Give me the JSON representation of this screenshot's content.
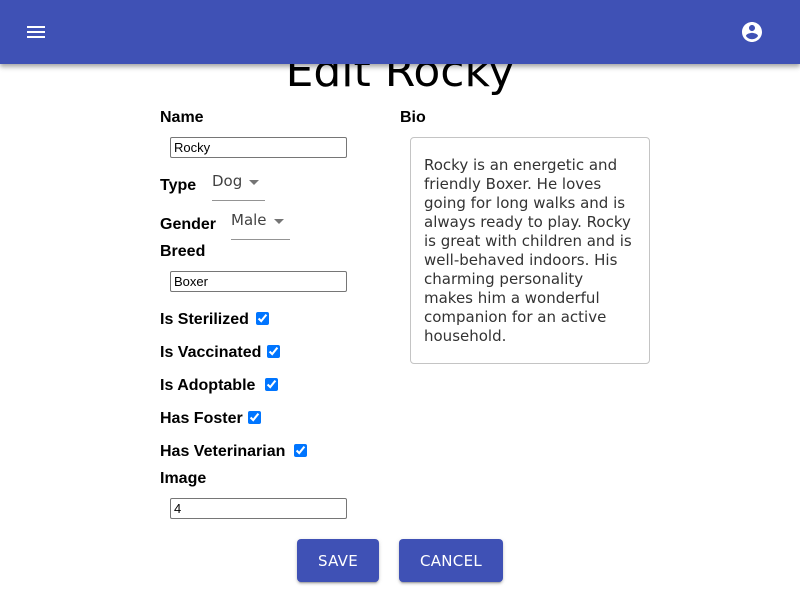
{
  "header": {
    "menu_icon": "menu-icon",
    "account_icon": "account-circle-icon",
    "bar_color": "#3f51b5"
  },
  "page": {
    "title": "Edit Rocky"
  },
  "form": {
    "name": {
      "label": "Name",
      "value": "Rocky"
    },
    "type": {
      "label": "Type",
      "value": "Dog"
    },
    "gender": {
      "label": "Gender",
      "value": "Male"
    },
    "breed": {
      "label": "Breed",
      "value": "Boxer"
    },
    "is_sterilized": {
      "label": "Is Sterilized",
      "checked": true
    },
    "is_vaccinated": {
      "label": "Is Vaccinated",
      "checked": true
    },
    "is_adoptable": {
      "label": "Is Adoptable",
      "checked": true
    },
    "has_foster": {
      "label": "Has Foster",
      "checked": true
    },
    "has_veterinarian": {
      "label": "Has Veterinarian",
      "checked": true
    },
    "image": {
      "label": "Image",
      "value": "4"
    },
    "bio": {
      "label": "Bio",
      "value": "Rocky is an energetic and friendly Boxer. He loves going for long walks and is always ready to play. Rocky is great with children and is well-behaved indoors. His charming personality makes him a wonderful companion for an active household."
    }
  },
  "actions": {
    "save": "SAVE",
    "cancel": "CANCEL",
    "button_color": "#3f51b5"
  }
}
